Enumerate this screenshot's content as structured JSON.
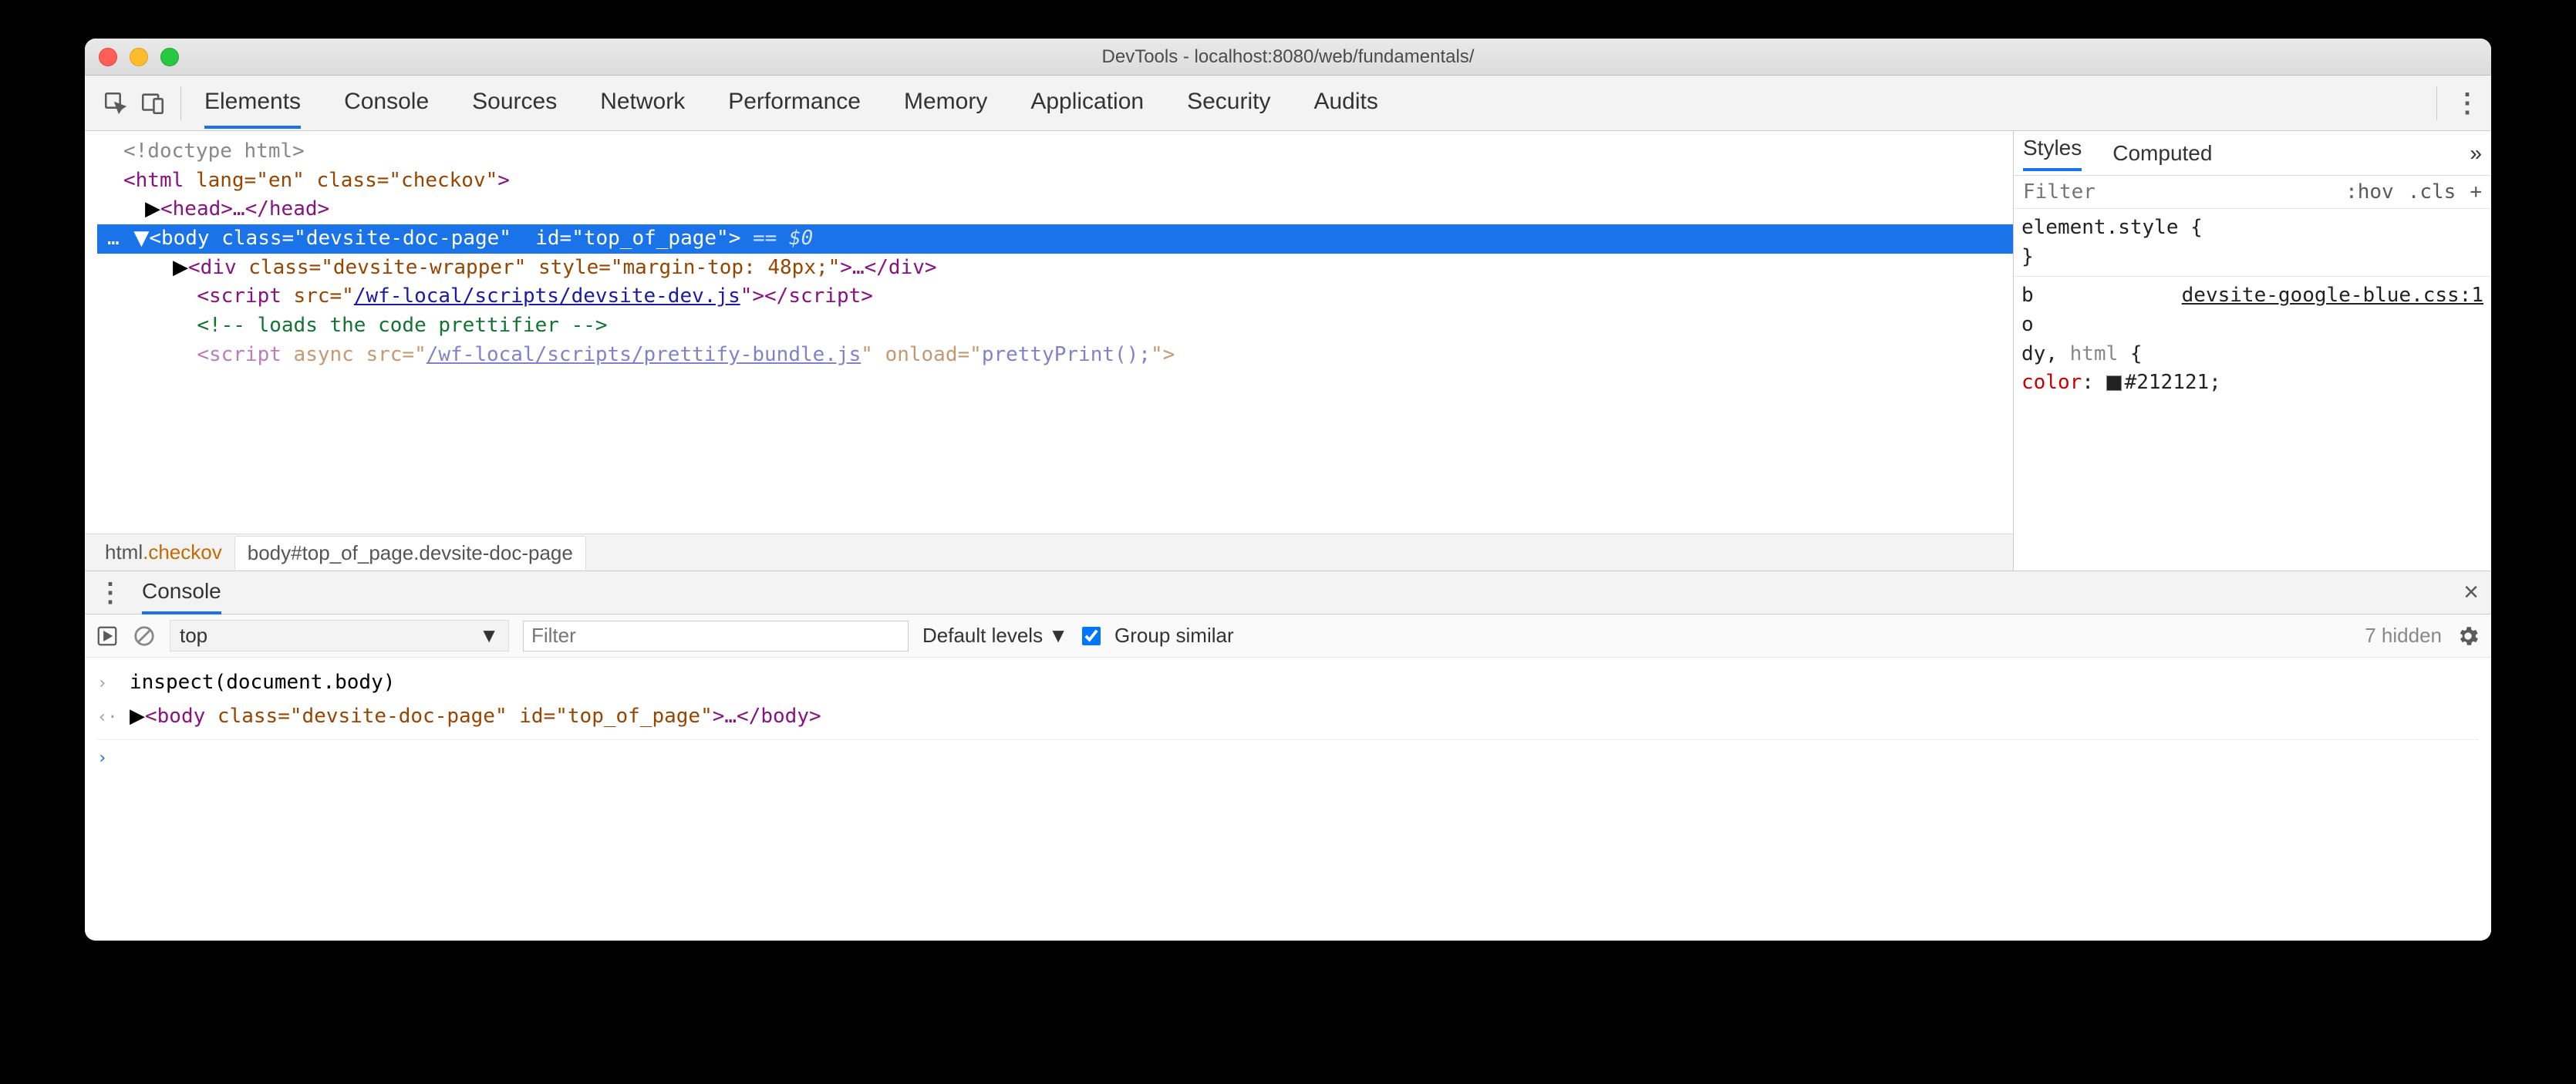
{
  "window": {
    "title": "DevTools - localhost:8080/web/fundamentals/"
  },
  "toolbar": {
    "tabs": [
      "Elements",
      "Console",
      "Sources",
      "Network",
      "Performance",
      "Memory",
      "Application",
      "Security",
      "Audits"
    ],
    "active_tab": "Elements"
  },
  "dom": {
    "l0": "<!doctype html>",
    "l1_open": "<",
    "l1_tag": "html",
    "l1_attrs": " lang=\"en\" class=\"checkov\"",
    "l1_close": ">",
    "l2_tri": "▶",
    "l2_open": "<",
    "l2_tag": "head",
    "l2_mid": ">…</",
    "l2_tag2": "head",
    "l2_close": ">",
    "sel_dots": "…",
    "sel_tri": "▼",
    "sel_open": "<",
    "sel_tag": "body",
    "sel_attrs": " class=\"devsite-doc-page\"  id=\"top_of_page\"",
    "sel_close": ">",
    "sel_eq": " == $0",
    "l4_tri": "▶",
    "l4_open": "<",
    "l4_tag": "div",
    "l4_attrs": " class=\"devsite-wrapper\" style=\"margin-top: 48px;\"",
    "l4_mid": ">…</",
    "l4_tag2": "div",
    "l4_close": ">",
    "l5_open": "<",
    "l5_tag": "script",
    "l5_attrs": " src=\"",
    "l5_link": "/wf-local/scripts/devsite-dev.js",
    "l5_mid": "\"></",
    "l5_tag2": "script",
    "l5_close": ">",
    "l6": "<!-- loads the code prettifier -->",
    "l7_open": "<",
    "l7_tag": "script",
    "l7_attrs": " async src=\"",
    "l7_link": "/wf-local/scripts/prettify-bundle.js",
    "l7_mid": "\" onload=\"",
    "l7_val": "prettyPrint();",
    "l7_close": "\">"
  },
  "crumbs": {
    "a_pre": "html",
    "a_suf": ".checkov",
    "b": "body#top_of_page.devsite-doc-page"
  },
  "sidebar": {
    "tabs": [
      "Styles",
      "Computed"
    ],
    "more": "»",
    "filter_placeholder": "Filter",
    "hov": ":hov",
    "cls": ".cls",
    "plus": "+",
    "rule1_a": "element.style {",
    "rule1_b": "}",
    "rule2_sel_a": "b",
    "rule2_sel_b": "o",
    "rule2_sel_c": "dy, ",
    "rule2_sel_c2": "html",
    "rule2_brace": " {",
    "rule2_file": "devsite-google-blue.css:1",
    "rule2_prop": "    color",
    "rule2_sep": ": ",
    "rule2_val": "#212121",
    "rule2_end": ";"
  },
  "drawer": {
    "tab": "Console",
    "context": "top",
    "context_arrow": "▼",
    "filter_placeholder": "Filter",
    "levels": "Default levels ▼",
    "group": "Group similar",
    "hidden": "7 hidden",
    "line1": "inspect(document.body)",
    "line2_open": "<",
    "line2_tag": "body",
    "line2_attrs": " class=\"devsite-doc-page\" id=\"top_of_page\"",
    "line2_mid": ">…</",
    "line2_tag2": "body",
    "line2_close": ">"
  }
}
